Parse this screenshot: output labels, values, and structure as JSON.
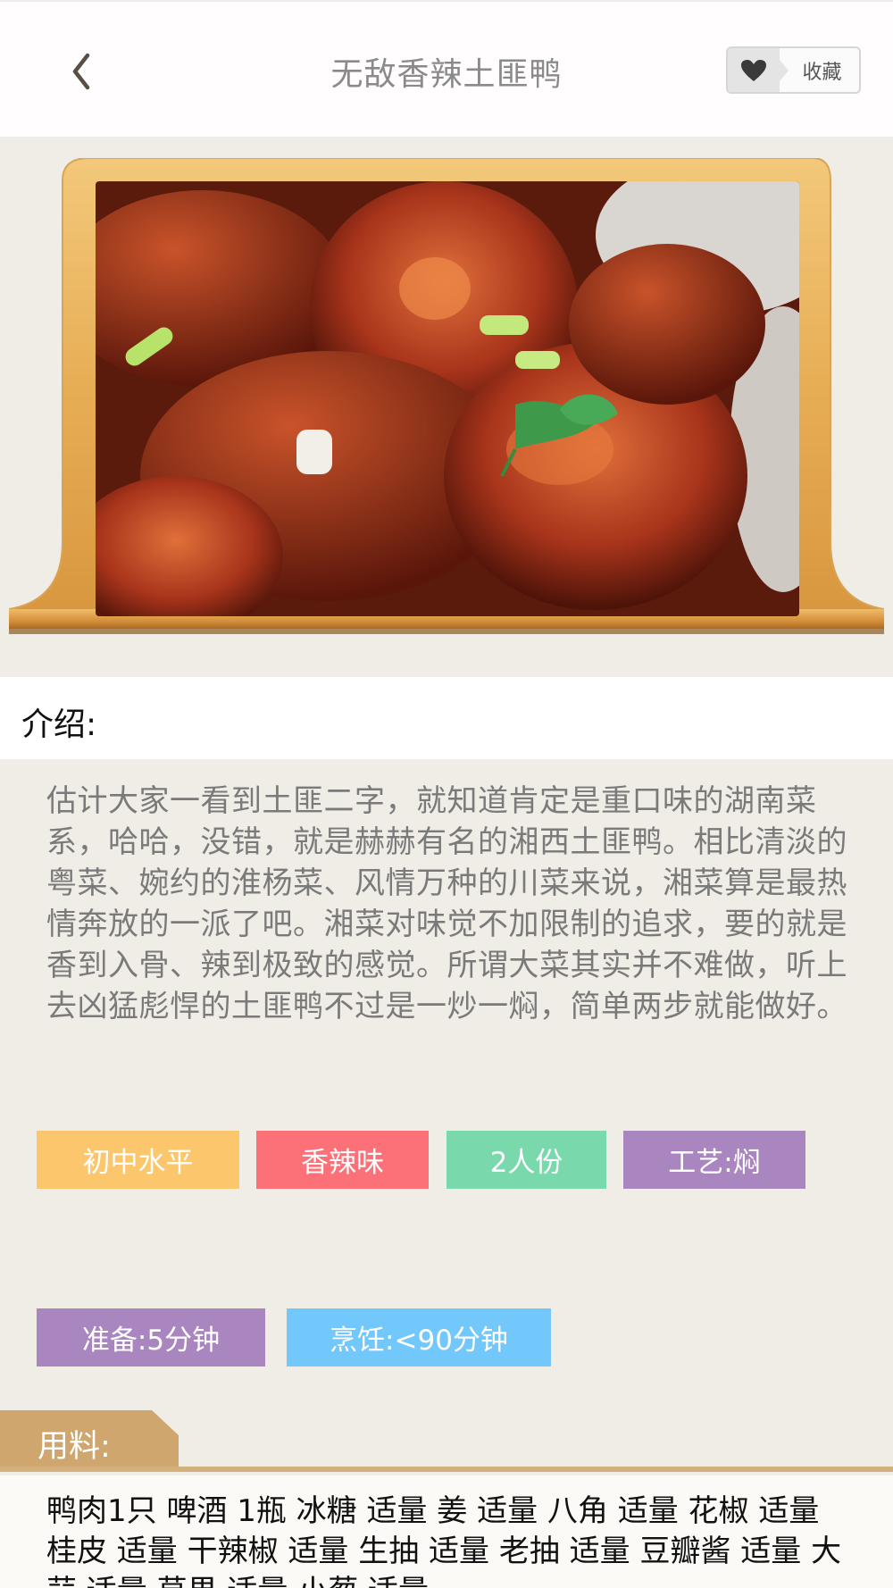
{
  "header": {
    "title": "无敌香辣土匪鸭",
    "favorite_label": "收藏"
  },
  "intro": {
    "label": "介绍:",
    "text": "估计大家一看到土匪二字，就知道肯定是重口味的湖南菜系，哈哈，没错，就是赫赫有名的湘西土匪鸭。相比清淡的粤菜、婉约的淮杨菜、风情万种的川菜来说，湘菜算是最热情奔放的一派了吧。湘菜对味觉不加限制的追求，要的就是香到入骨、辣到极致的感觉。所谓大菜其实并不难做，听上去凶猛彪悍的土匪鸭不过是一炒一焖，简单两步就能做好。"
  },
  "tags": {
    "level": "初中水平",
    "flavor": "香辣味",
    "servings": "2人份",
    "technique": "工艺:焖",
    "prep": "准备:5分钟",
    "cook": "烹饪:<90分钟"
  },
  "ingredients": {
    "label": "用料:",
    "text": "鸭肉1只  啤酒 1瓶  冰糖 适量  姜 适量  八角 适量  花椒 适量  桂皮 适量  干辣椒 适量  生抽 适量  老抽 适量  豆瓣酱 适量  大蒜 适量  草果 适量  小葱 适量"
  },
  "colors": {
    "tag_level": "#fcc76c",
    "tag_flavor": "#fb7177",
    "tag_servings": "#79d9ad",
    "tag_technique": "#aa86c1",
    "tag_prep": "#aa86c1",
    "tag_cook": "#73c8fb",
    "ingredients_accent": "#cfa66d"
  },
  "icons": {
    "back": "chevron-left-icon",
    "favorite": "heart-icon"
  }
}
